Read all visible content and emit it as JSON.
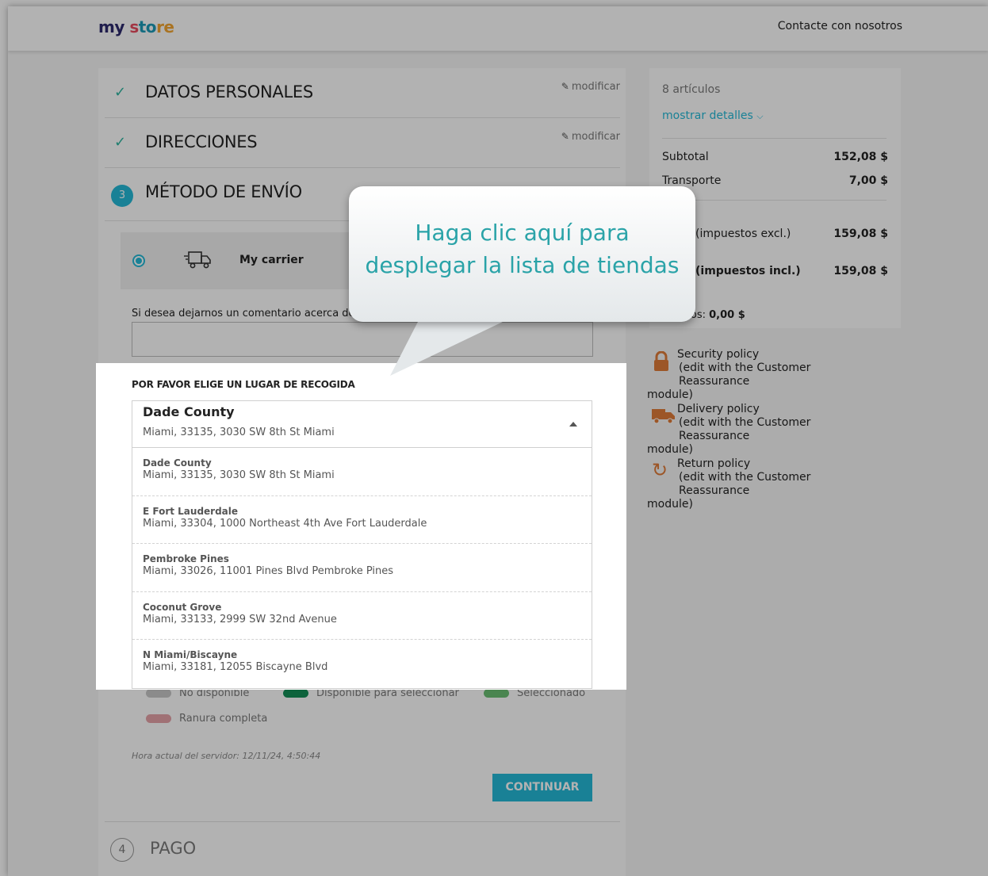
{
  "header": {
    "logo_part1": "my ",
    "logo_part2": "s",
    "logo_part3": "to",
    "logo_part4": "re",
    "contact": "Contacte con nosotros"
  },
  "steps": {
    "personal": {
      "title": "DATOS PERSONALES",
      "edit": "modificar"
    },
    "addresses": {
      "title": "DIRECCIONES",
      "edit": "modificar"
    },
    "shipping": {
      "number": "3",
      "title": "MÉTODO DE ENVÍO"
    },
    "payment": {
      "number": "4",
      "title": "PAGO"
    }
  },
  "shipping": {
    "carrier_name": "My carrier",
    "comment_label": "Si desea dejarnos un comentario acerca de s",
    "pickup_title": "POR FAVOR ELIGE UN LUGAR DE RECOGIDA",
    "selected": {
      "name": "Dade County",
      "address": "Miami, 33135, 3030 SW 8th St Miami"
    },
    "options": [
      {
        "name": "Dade County",
        "address": "Miami, 33135, 3030 SW 8th St Miami"
      },
      {
        "name": "E Fort Lauderdale",
        "address": "Miami, 33304, 1000 Northeast 4th Ave Fort Lauderdale"
      },
      {
        "name": "Pembroke Pines",
        "address": "Miami, 33026, 11001 Pines Blvd Pembroke Pines"
      },
      {
        "name": "Coconut Grove",
        "address": "Miami, 33133, 2999 SW 32nd Avenue"
      },
      {
        "name": "N Miami/Biscayne",
        "address": "Miami, 33181, 12055 Biscayne Blvd"
      }
    ],
    "legend": {
      "unavailable": "No disponible",
      "available": "Disponible para seleccionar",
      "selected": "Seleccionado",
      "full": "Ranura completa"
    },
    "legend_colors": {
      "unavailable": "#c8c8c8",
      "available": "#138f57",
      "selected": "#6bbf73",
      "full": "#e6a3a8"
    },
    "server_time": "Hora actual del servidor: 12/11/24, 4:50:44",
    "continue": "CONTINUAR"
  },
  "summary": {
    "items_count": "8 artículos",
    "show_details": "mostrar detalles",
    "subtotal_label": "Subtotal",
    "subtotal_value": "152,08 $",
    "shipping_label": "Transporte",
    "shipping_value": "7,00 $",
    "total_excl_label": "(impuestos excl.)",
    "total_excl_value": "159,08 $",
    "total_incl_label": "(impuestos incl.)",
    "total_incl_value": "159,08 $",
    "taxes_label": "stos:",
    "taxes_value": "0,00 $"
  },
  "reassurance": [
    {
      "title": "Security policy",
      "line2": "(edit with the Customer Reassurance",
      "line3": "module)",
      "icon": "lock-icon"
    },
    {
      "title": "Delivery policy",
      "line2": "(edit with the Customer Reassurance",
      "line3": "module)",
      "icon": "truck-icon"
    },
    {
      "title": "Return policy",
      "line2": "(edit with the Customer Reassurance",
      "line3": "module)",
      "icon": "refresh-icon"
    }
  ],
  "callout": {
    "line1": "Haga clic aquí para",
    "line2": "desplegar la lista de tiendas"
  }
}
